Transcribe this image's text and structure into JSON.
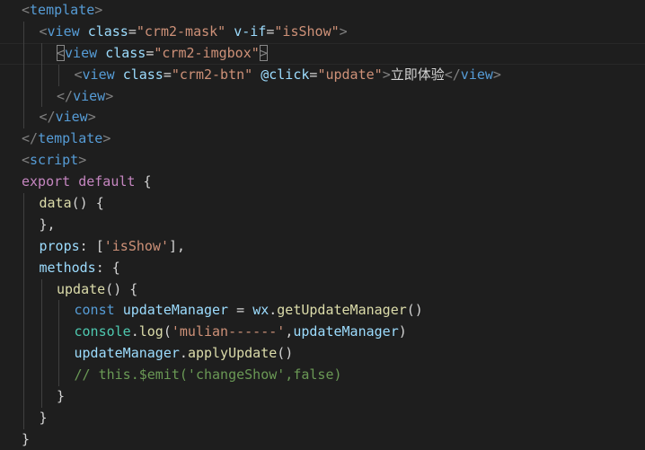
{
  "editor": {
    "language": "vue",
    "theme_colors": {
      "background": "#1e1e1e",
      "tag": "#569cd6",
      "punctuation": "#808080",
      "attribute": "#9cdcfe",
      "string": "#ce9178",
      "keyword": "#c586c0",
      "function": "#dcdcaa",
      "comment": "#6a9955",
      "class": "#4ec9b0",
      "text": "#d4d4d4"
    },
    "lines": [
      {
        "indent": 0,
        "tokens": [
          [
            "punc",
            "<"
          ],
          [
            "tag",
            "template"
          ],
          [
            "punc",
            ">"
          ]
        ]
      },
      {
        "indent": 1,
        "tokens": [
          [
            "punc",
            "<"
          ],
          [
            "tag",
            "view"
          ],
          [
            "text",
            " "
          ],
          [
            "attr",
            "class"
          ],
          [
            "eq",
            "="
          ],
          [
            "str",
            "\"crm2-mask\""
          ],
          [
            "text",
            " "
          ],
          [
            "attr",
            "v-if"
          ],
          [
            "eq",
            "="
          ],
          [
            "str",
            "\"isShow\""
          ],
          [
            "punc",
            ">"
          ]
        ]
      },
      {
        "indent": 2,
        "cursor": true,
        "tokens": [
          [
            "punc",
            "<",
            "match"
          ],
          [
            "tag",
            "view"
          ],
          [
            "text",
            " "
          ],
          [
            "attr",
            "class"
          ],
          [
            "eq",
            "="
          ],
          [
            "str",
            "\"crm2-imgbox\""
          ],
          [
            "punc",
            ">",
            "match"
          ]
        ]
      },
      {
        "indent": 3,
        "tokens": [
          [
            "punc",
            "<"
          ],
          [
            "tag",
            "view"
          ],
          [
            "text",
            " "
          ],
          [
            "attr",
            "class"
          ],
          [
            "eq",
            "="
          ],
          [
            "str",
            "\"crm2-btn\""
          ],
          [
            "text",
            " "
          ],
          [
            "dir",
            "@click"
          ],
          [
            "eq",
            "="
          ],
          [
            "str",
            "\"update\""
          ],
          [
            "punc",
            ">"
          ],
          [
            "text",
            "立即体验"
          ],
          [
            "punc",
            "</"
          ],
          [
            "tag",
            "view"
          ],
          [
            "punc",
            ">"
          ]
        ]
      },
      {
        "indent": 2,
        "tokens": [
          [
            "punc",
            "</"
          ],
          [
            "tag",
            "view"
          ],
          [
            "punc",
            ">"
          ]
        ]
      },
      {
        "indent": 1,
        "tokens": [
          [
            "punc",
            "</"
          ],
          [
            "tag",
            "view"
          ],
          [
            "punc",
            ">"
          ]
        ]
      },
      {
        "indent": 0,
        "tokens": [
          [
            "punc",
            "</"
          ],
          [
            "tag",
            "template"
          ],
          [
            "punc",
            ">"
          ]
        ]
      },
      {
        "indent": 0,
        "tokens": [
          [
            "punc",
            "<"
          ],
          [
            "tag",
            "script"
          ],
          [
            "punc",
            ">"
          ]
        ]
      },
      {
        "indent": 0,
        "tokens": [
          [
            "kw",
            "export"
          ],
          [
            "text",
            " "
          ],
          [
            "kw",
            "default"
          ],
          [
            "text",
            " {"
          ]
        ]
      },
      {
        "indent": 1,
        "tokens": [
          [
            "fn",
            "data"
          ],
          [
            "text",
            "() {"
          ]
        ]
      },
      {
        "indent": 1,
        "tokens": [
          [
            "text",
            "},"
          ]
        ]
      },
      {
        "indent": 1,
        "tokens": [
          [
            "prop",
            "props"
          ],
          [
            "text",
            ": ["
          ],
          [
            "str",
            "'isShow'"
          ],
          [
            "text",
            "],"
          ]
        ]
      },
      {
        "indent": 1,
        "tokens": [
          [
            "prop",
            "methods"
          ],
          [
            "text",
            ": {"
          ]
        ]
      },
      {
        "indent": 2,
        "tokens": [
          [
            "fn",
            "update"
          ],
          [
            "text",
            "() {"
          ]
        ]
      },
      {
        "indent": 3,
        "tokens": [
          [
            "const",
            "const"
          ],
          [
            "text",
            " "
          ],
          [
            "var",
            "updateManager"
          ],
          [
            "text",
            " = "
          ],
          [
            "var",
            "wx"
          ],
          [
            "text",
            "."
          ],
          [
            "fn",
            "getUpdateManager"
          ],
          [
            "text",
            "()"
          ]
        ]
      },
      {
        "indent": 3,
        "tokens": [
          [
            "cls",
            "console"
          ],
          [
            "text",
            "."
          ],
          [
            "fn",
            "log"
          ],
          [
            "text",
            "("
          ],
          [
            "str",
            "'mulian------'"
          ],
          [
            "text",
            ","
          ],
          [
            "var",
            "updateManager"
          ],
          [
            "text",
            ")"
          ]
        ]
      },
      {
        "indent": 3,
        "tokens": [
          [
            "var",
            "updateManager"
          ],
          [
            "text",
            "."
          ],
          [
            "fn",
            "applyUpdate"
          ],
          [
            "text",
            "()"
          ]
        ]
      },
      {
        "indent": 3,
        "tokens": [
          [
            "com",
            "// this.$emit('changeShow',false)"
          ]
        ]
      },
      {
        "indent": 2,
        "tokens": [
          [
            "text",
            "}"
          ]
        ]
      },
      {
        "indent": 1,
        "tokens": [
          [
            "text",
            "}"
          ]
        ]
      },
      {
        "indent": 0,
        "tokens": [
          [
            "text",
            "}"
          ]
        ]
      }
    ]
  }
}
